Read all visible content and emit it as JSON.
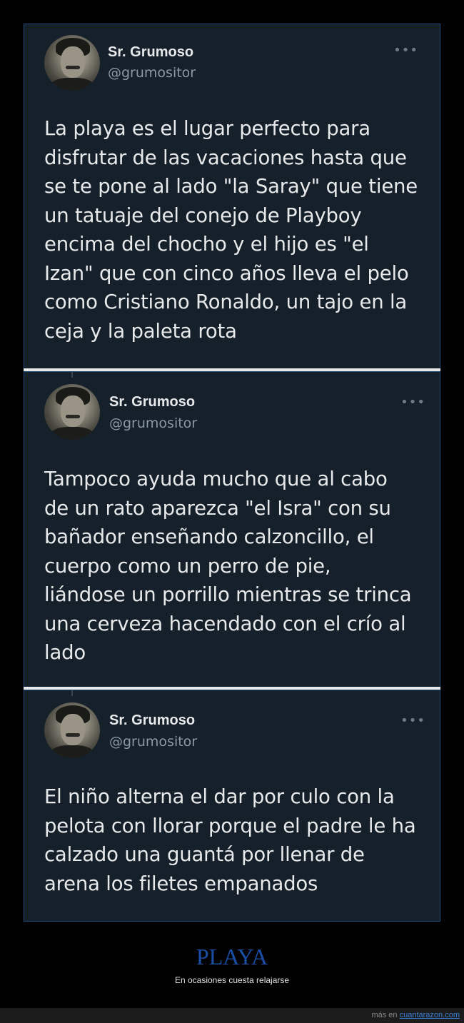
{
  "tweets": [
    {
      "name": "Sr. Grumoso",
      "handle": "@grumositor",
      "more_icon": "more-horizontal-icon",
      "lines": [
        "La playa es el lugar perfecto para",
        "disfrutar de las vacaciones hasta que",
        "se te pone al lado \"la Saray\" que tiene",
        "un tatuaje del conejo de Playboy",
        "encima del chocho y el hijo es \"el",
        "Izan\" que con cinco años lleva el pelo",
        "como Cristiano Ronaldo, un tajo en la",
        "ceja y la paleta rota"
      ]
    },
    {
      "name": "Sr. Grumoso",
      "handle": "@grumositor",
      "more_icon": "more-horizontal-icon",
      "lines": [
        "Tampoco ayuda mucho que al cabo",
        "de un rato aparezca \"el Isra\" con su",
        "bañador enseñando calzoncillo, el",
        "cuerpo como un perro de pie,",
        "liándose un porrillo mientras se trinca",
        "una cerveza hacendado con el crío al",
        "lado"
      ]
    },
    {
      "name": "Sr. Grumoso",
      "handle": "@grumositor",
      "more_icon": "more-horizontal-icon",
      "lines": [
        "El niño alterna el dar por culo con la",
        "pelota con llorar porque el padre le ha",
        "calzado una guantá por llenar de",
        "arena los filetes empanados"
      ]
    }
  ],
  "caption": {
    "title": "PLAYA",
    "subtitle": "En ocasiones cuesta relajarse"
  },
  "footer": {
    "prefix": "más en ",
    "link": "cuantarazon.com"
  },
  "colors": {
    "tweet_bg": "#15202b",
    "text": "#e7e9ea",
    "secondary": "#8b98a5",
    "title_blue": "#1b4fa6",
    "link_blue": "#3b7fd8"
  }
}
